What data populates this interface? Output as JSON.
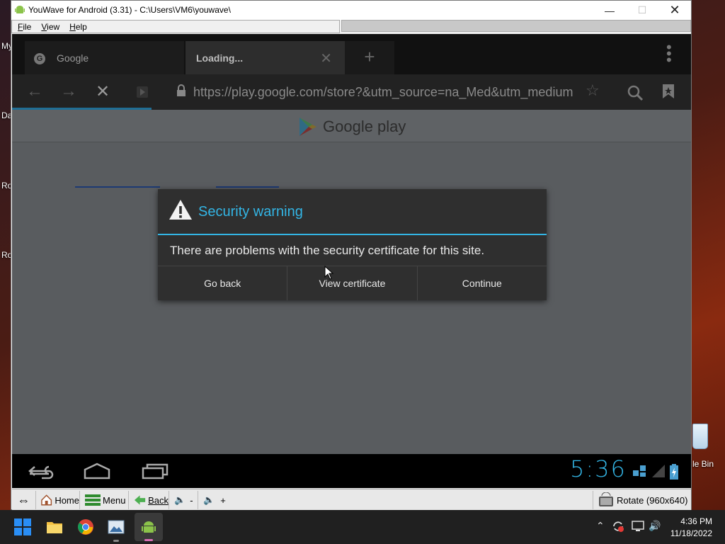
{
  "window": {
    "title": "YouWave for Android (3.31) - C:\\Users\\VM6\\youwave\\",
    "menu": [
      "File",
      "View",
      "Help"
    ]
  },
  "browser": {
    "tabs": [
      {
        "label": "Google"
      },
      {
        "label": "Loading..."
      }
    ],
    "url": "https://play.google.com/store?&utm_source=na_Med&utm_medium",
    "page_logo_text": "Google play"
  },
  "dialog": {
    "title": "Security warning",
    "message": "There are problems with the security certificate for this site.",
    "buttons": [
      "Go back",
      "View certificate",
      "Continue"
    ]
  },
  "android_status": {
    "clock": "5:36"
  },
  "toolbar": {
    "home": "Home",
    "menu": "Menu",
    "back": "Back",
    "vol_down": "-",
    "vol_up": "+",
    "rotate": "Rotate (960x640)"
  },
  "desktop": {
    "labels": [
      "My",
      "Da",
      "Ro",
      "Ro"
    ],
    "recycle_bin": "le Bin"
  },
  "taskbar": {
    "time": "4:36 PM",
    "date": "11/18/2022"
  },
  "colors": {
    "accent": "#33b5e5",
    "dialog_bg": "#2f2f2f"
  }
}
